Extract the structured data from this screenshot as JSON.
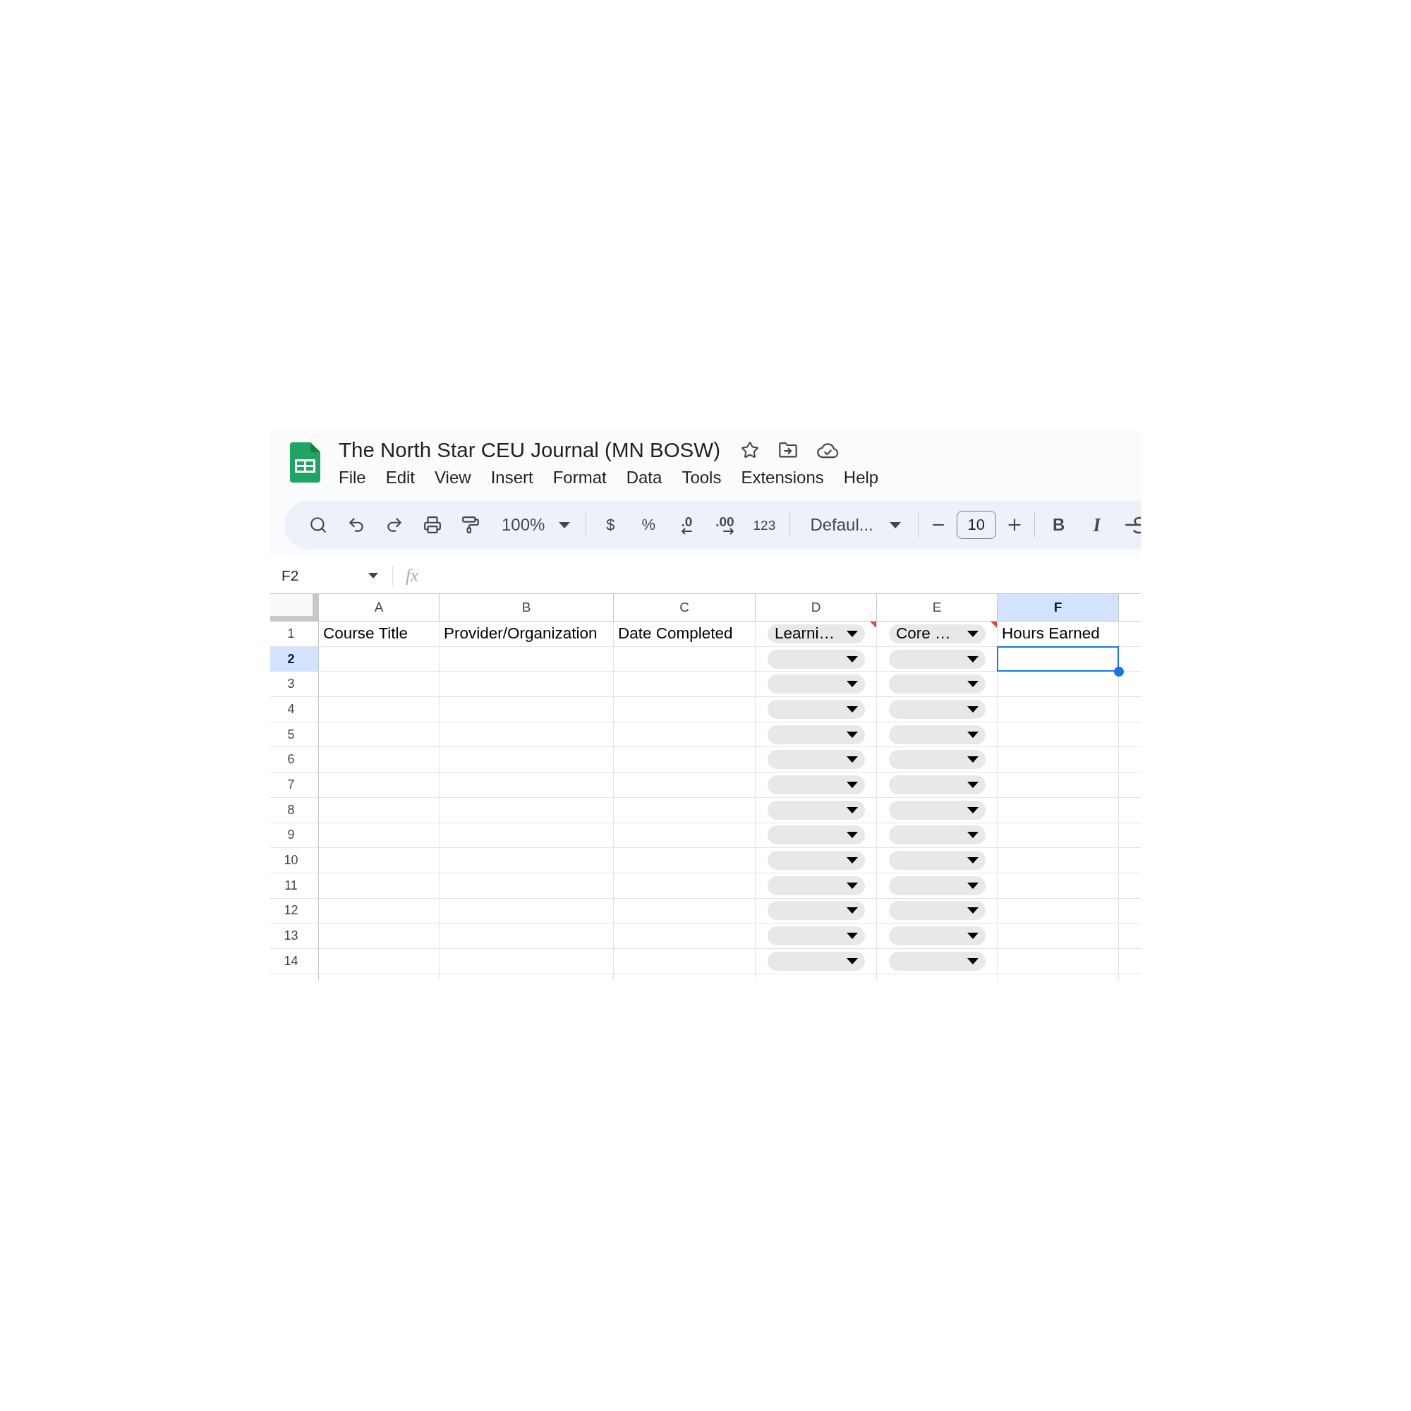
{
  "document": {
    "title": "The North Star CEU Journal (MN BOSW)"
  },
  "menu": [
    "File",
    "Edit",
    "View",
    "Insert",
    "Format",
    "Data",
    "Tools",
    "Extensions",
    "Help"
  ],
  "toolbar": {
    "zoom": "100%",
    "currency": "$",
    "percent": "%",
    "decrease_decimals": ".0",
    "increase_decimals": ".00",
    "number_formats": "123",
    "font": "Defaul...",
    "font_size": "10",
    "bold": "B",
    "italic": "I"
  },
  "formula_bar": {
    "name_box": "F2",
    "function_label": "fx"
  },
  "sheet": {
    "columns": [
      {
        "letter": "A",
        "selected": false
      },
      {
        "letter": "B",
        "selected": false
      },
      {
        "letter": "C",
        "selected": false
      },
      {
        "letter": "D",
        "selected": false
      },
      {
        "letter": "E",
        "selected": false
      },
      {
        "letter": "F",
        "selected": true
      }
    ],
    "rows": [
      {
        "number": "1",
        "selected": false,
        "cells": [
          {
            "kind": "text",
            "value": "Course Title",
            "note": false
          },
          {
            "kind": "text",
            "value": "Provider/Organization",
            "note": false
          },
          {
            "kind": "text",
            "value": "Date Completed",
            "note": false
          },
          {
            "kind": "dropdown",
            "value": "Learni…",
            "note": true
          },
          {
            "kind": "dropdown",
            "value": "Core …",
            "note": true
          },
          {
            "kind": "text",
            "value": "Hours Earned",
            "note": false
          }
        ]
      },
      {
        "number": "2",
        "selected": true,
        "cells": [
          {
            "kind": "text",
            "note": false
          },
          {
            "kind": "text",
            "note": false
          },
          {
            "kind": "text",
            "note": false
          },
          {
            "kind": "dropdown",
            "note": false
          },
          {
            "kind": "dropdown",
            "note": false
          },
          {
            "kind": "text",
            "note": false
          }
        ]
      },
      {
        "number": "3",
        "selected": false,
        "cells": [
          {
            "kind": "text",
            "note": false
          },
          {
            "kind": "text",
            "note": false
          },
          {
            "kind": "text",
            "note": false
          },
          {
            "kind": "dropdown",
            "note": false
          },
          {
            "kind": "dropdown",
            "note": false
          },
          {
            "kind": "text",
            "note": false
          }
        ]
      },
      {
        "number": "4",
        "selected": false,
        "cells": [
          {
            "kind": "text",
            "note": false
          },
          {
            "kind": "text",
            "note": false
          },
          {
            "kind": "text",
            "note": false
          },
          {
            "kind": "dropdown",
            "note": false
          },
          {
            "kind": "dropdown",
            "note": false
          },
          {
            "kind": "text",
            "note": false
          }
        ]
      },
      {
        "number": "5",
        "selected": false,
        "cells": [
          {
            "kind": "text",
            "note": false
          },
          {
            "kind": "text",
            "note": false
          },
          {
            "kind": "text",
            "note": false
          },
          {
            "kind": "dropdown",
            "note": false
          },
          {
            "kind": "dropdown",
            "note": false
          },
          {
            "kind": "text",
            "note": false
          }
        ]
      },
      {
        "number": "6",
        "selected": false,
        "cells": [
          {
            "kind": "text",
            "note": false
          },
          {
            "kind": "text",
            "note": false
          },
          {
            "kind": "text",
            "note": false
          },
          {
            "kind": "dropdown",
            "note": false
          },
          {
            "kind": "dropdown",
            "note": false
          },
          {
            "kind": "text",
            "note": false
          }
        ]
      },
      {
        "number": "7",
        "selected": false,
        "cells": [
          {
            "kind": "text",
            "note": false
          },
          {
            "kind": "text",
            "note": false
          },
          {
            "kind": "text",
            "note": false
          },
          {
            "kind": "dropdown",
            "note": false
          },
          {
            "kind": "dropdown",
            "note": false
          },
          {
            "kind": "text",
            "note": false
          }
        ]
      },
      {
        "number": "8",
        "selected": false,
        "cells": [
          {
            "kind": "text",
            "note": false
          },
          {
            "kind": "text",
            "note": false
          },
          {
            "kind": "text",
            "note": false
          },
          {
            "kind": "dropdown",
            "note": false
          },
          {
            "kind": "dropdown",
            "note": false
          },
          {
            "kind": "text",
            "note": false
          }
        ]
      },
      {
        "number": "9",
        "selected": false,
        "cells": [
          {
            "kind": "text",
            "note": false
          },
          {
            "kind": "text",
            "note": false
          },
          {
            "kind": "text",
            "note": false
          },
          {
            "kind": "dropdown",
            "note": false
          },
          {
            "kind": "dropdown",
            "note": false
          },
          {
            "kind": "text",
            "note": false
          }
        ]
      },
      {
        "number": "10",
        "selected": false,
        "cells": [
          {
            "kind": "text",
            "note": false
          },
          {
            "kind": "text",
            "note": false
          },
          {
            "kind": "text",
            "note": false
          },
          {
            "kind": "dropdown",
            "note": false
          },
          {
            "kind": "dropdown",
            "note": false
          },
          {
            "kind": "text",
            "note": false
          }
        ]
      },
      {
        "number": "11",
        "selected": false,
        "cells": [
          {
            "kind": "text",
            "note": false
          },
          {
            "kind": "text",
            "note": false
          },
          {
            "kind": "text",
            "note": false
          },
          {
            "kind": "dropdown",
            "note": false
          },
          {
            "kind": "dropdown",
            "note": false
          },
          {
            "kind": "text",
            "note": false
          }
        ]
      },
      {
        "number": "12",
        "selected": false,
        "cells": [
          {
            "kind": "text",
            "note": false
          },
          {
            "kind": "text",
            "note": false
          },
          {
            "kind": "text",
            "note": false
          },
          {
            "kind": "dropdown",
            "note": false
          },
          {
            "kind": "dropdown",
            "note": false
          },
          {
            "kind": "text",
            "note": false
          }
        ]
      },
      {
        "number": "13",
        "selected": false,
        "cells": [
          {
            "kind": "text",
            "note": false
          },
          {
            "kind": "text",
            "note": false
          },
          {
            "kind": "text",
            "note": false
          },
          {
            "kind": "dropdown",
            "note": false
          },
          {
            "kind": "dropdown",
            "note": false
          },
          {
            "kind": "text",
            "note": false
          }
        ]
      },
      {
        "number": "14",
        "selected": false,
        "cells": [
          {
            "kind": "text",
            "note": false
          },
          {
            "kind": "text",
            "note": false
          },
          {
            "kind": "text",
            "note": false
          },
          {
            "kind": "dropdown",
            "note": false
          },
          {
            "kind": "dropdown",
            "note": false
          },
          {
            "kind": "text",
            "note": false
          }
        ]
      }
    ]
  }
}
